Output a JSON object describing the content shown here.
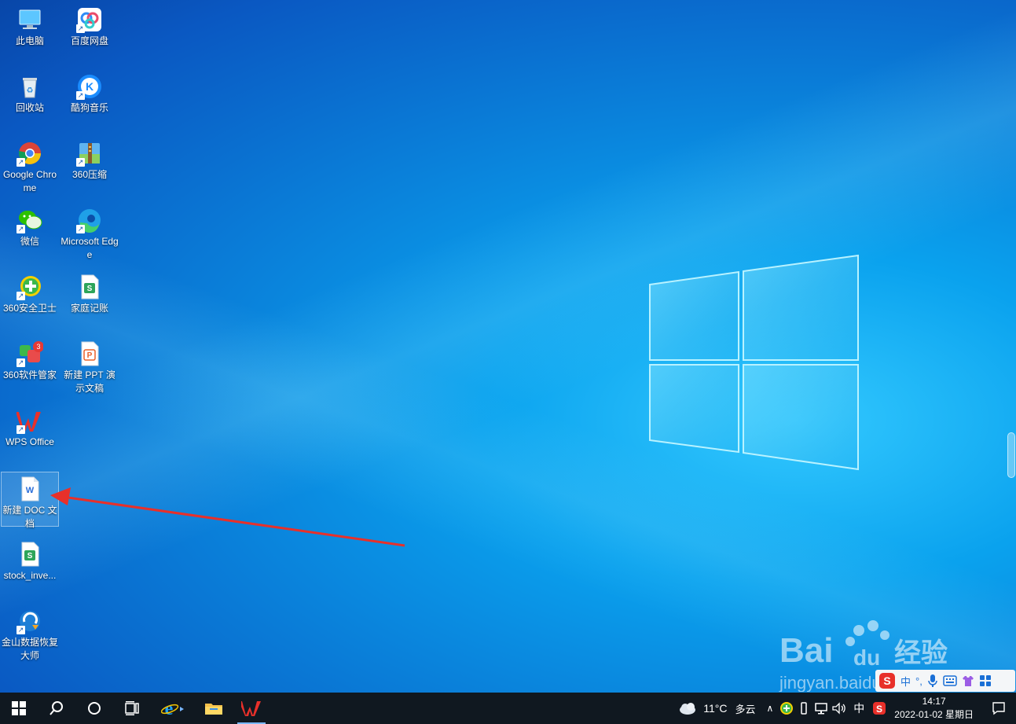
{
  "desktop_icons_col1": [
    {
      "label": "此电脑",
      "icon": "computer-icon"
    },
    {
      "label": "回收站",
      "icon": "recycle-bin-icon"
    },
    {
      "label": "Google Chrome",
      "icon": "chrome-icon"
    },
    {
      "label": "微信",
      "icon": "wechat-icon"
    },
    {
      "label": "360安全卫士",
      "icon": "360-security-icon"
    },
    {
      "label": "360软件管家",
      "icon": "360-software-icon",
      "badge": "3"
    },
    {
      "label": "WPS Office",
      "icon": "wps-icon"
    },
    {
      "label": "新建 DOC 文档",
      "icon": "word-doc-icon",
      "selected": true
    },
    {
      "label": "stock_inve...",
      "icon": "spreadsheet-icon"
    },
    {
      "label": "金山数据恢复大师",
      "icon": "data-recovery-icon"
    }
  ],
  "desktop_icons_col2": [
    {
      "label": "百度网盘",
      "icon": "baidu-netdisk-icon"
    },
    {
      "label": "酷狗音乐",
      "icon": "kugou-music-icon"
    },
    {
      "label": "360压缩",
      "icon": "360-zip-icon"
    },
    {
      "label": "Microsoft Edge",
      "icon": "edge-icon"
    },
    {
      "label": "家庭记账",
      "icon": "spreadsheet-icon"
    },
    {
      "label": "新建 PPT 演示文稿",
      "icon": "ppt-icon"
    }
  ],
  "taskbar": {
    "weather_temp": "11°C",
    "weather_desc": "多云",
    "ime_indicator": "中",
    "time": "14:17",
    "date": "2022-01-02 星期日"
  },
  "ime_toolbar": {
    "mode": "中",
    "punct": "°,"
  },
  "watermark": {
    "brand": "Bai",
    "paw": "du",
    "cn": "经验",
    "url": "jingyan.baidu.com"
  },
  "colors": {
    "accent_red": "#e8302a",
    "taskbar_bg": "#101820"
  }
}
